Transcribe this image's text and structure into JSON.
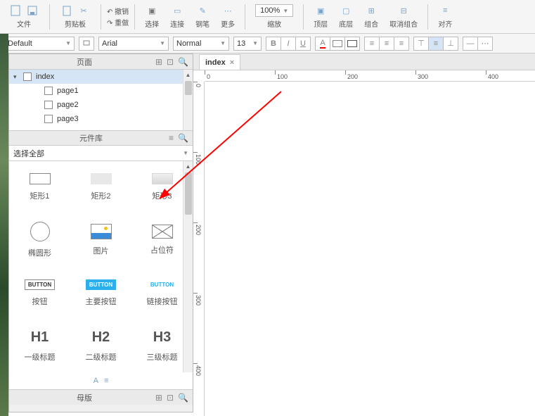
{
  "toolbar": {
    "file": "文件",
    "clipboard": "剪贴板",
    "undo": "撤销",
    "redo": "重做",
    "select": "选择",
    "connect": "连接",
    "pen": "钢笔",
    "more": "更多",
    "zoom_value": "100%",
    "zoom_label": "缩放",
    "top": "顶层",
    "bottom": "底层",
    "group": "组合",
    "ungroup": "取消组合",
    "align": "对齐"
  },
  "format": {
    "style_preset": "Default",
    "font": "Arial",
    "weight": "Normal",
    "size": "13"
  },
  "pages_panel": {
    "title": "页面",
    "root": "index",
    "children": [
      "page1",
      "page2",
      "page3"
    ]
  },
  "library_panel": {
    "title": "元件库",
    "select_all": "选择全部",
    "widgets": [
      {
        "label": "矩形1",
        "shape": "rect"
      },
      {
        "label": "矩形2",
        "shape": "rect-grey"
      },
      {
        "label": "矩形3",
        "shape": "rect-grad"
      },
      {
        "label": "椭圆形",
        "shape": "circle"
      },
      {
        "label": "图片",
        "shape": "image"
      },
      {
        "label": "占位符",
        "shape": "placeholder"
      },
      {
        "label": "按钮",
        "shape": "button",
        "text": "BUTTON"
      },
      {
        "label": "主要按钮",
        "shape": "button-primary",
        "text": "BUTTON"
      },
      {
        "label": "链接按钮",
        "shape": "button-link",
        "text": "BUTTON"
      },
      {
        "label": "一级标题",
        "shape": "heading",
        "text": "H1"
      },
      {
        "label": "二级标题",
        "shape": "heading",
        "text": "H2"
      },
      {
        "label": "三级标题",
        "shape": "heading",
        "text": "H3"
      }
    ]
  },
  "master_panel": {
    "title": "母版"
  },
  "canvas": {
    "tab_name": "index",
    "ruler_h": [
      0,
      100,
      200,
      300,
      400
    ],
    "ruler_v": [
      0,
      100,
      200,
      300,
      400
    ]
  }
}
